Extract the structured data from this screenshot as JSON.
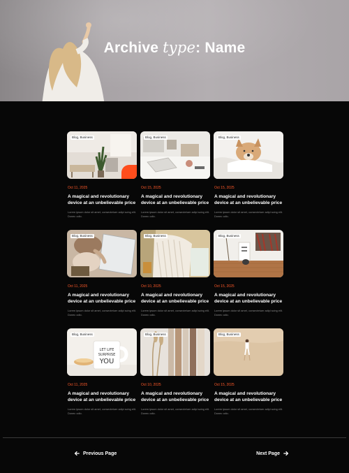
{
  "hero": {
    "title_part1": "Archive",
    "title_part2": "type",
    "title_part3": ": Name"
  },
  "posts": [
    {
      "tag": "Blog, Business",
      "date": "Oct 11, 2025",
      "title": "A magical and revolutionary device at an unbelievable price",
      "excerpt": "Lorem ipsum dolor sit amet, consectetuer adipi scing elit. Donec odio."
    },
    {
      "tag": "Blog, Business",
      "date": "Oct 15, 2025",
      "title": "A magical and revolutionary device at an unbelievable price",
      "excerpt": "Lorem ipsum dolor sit amet, consectetuer adipi scing elit. Donec odio."
    },
    {
      "tag": "Blog, Business",
      "date": "Oct 15, 2025",
      "title": "A magical and revolutionary device at an unbelievable price",
      "excerpt": "Lorem ipsum dolor sit amet, consectetuer adipi scing elit. Donec odio."
    },
    {
      "tag": "Blog, Business",
      "date": "Oct 11, 2025",
      "title": "A magical and revolutionary device at an unbelievable price",
      "excerpt": "Lorem ipsum dolor sit amet, consectetuer adipi scing elit. Donec odio."
    },
    {
      "tag": "Blog, Business",
      "date": "Oct 10, 2025",
      "title": "A magical and revolutionary device at an unbelievable price",
      "excerpt": "Lorem ipsum dolor sit amet, consectetuer adipi scing elit. Donec odio."
    },
    {
      "tag": "Blog, Business",
      "date": "Oct 15, 2025",
      "title": "A magical and revolutionary device at an unbelievable price",
      "excerpt": "Lorem ipsum dolor sit amet, consectetuer adipi scing elit. Donec odio."
    },
    {
      "tag": "Blog, Business",
      "date": "Oct 11, 2025",
      "title": "A magical and revolutionary device at an unbelievable price",
      "excerpt": "Lorem ipsum dolor sit amet, consectetuer adipi scing elit. Donec odio."
    },
    {
      "tag": "Blog, Business",
      "date": "Oct 10, 2025",
      "title": "A magical and revolutionary device at an unbelievable price",
      "excerpt": "Lorem ipsum dolor sit amet, consectetuer adipi scing elit. Donec odio."
    },
    {
      "tag": "Blog, Business",
      "date": "Oct 15, 2025",
      "title": "A magical and revolutionary device at an unbelievable price",
      "excerpt": "Lorem ipsum dolor sit amet, consectetuer adipi scing elit. Donec odio."
    }
  ],
  "mug_text": [
    "LET LIFE",
    "SURPRISE",
    "YOU"
  ],
  "pagination": {
    "prev_label": "Previous Page",
    "next_label": "Next Page"
  },
  "colors": {
    "accent": "#ff4d1c",
    "background": "#070707"
  }
}
